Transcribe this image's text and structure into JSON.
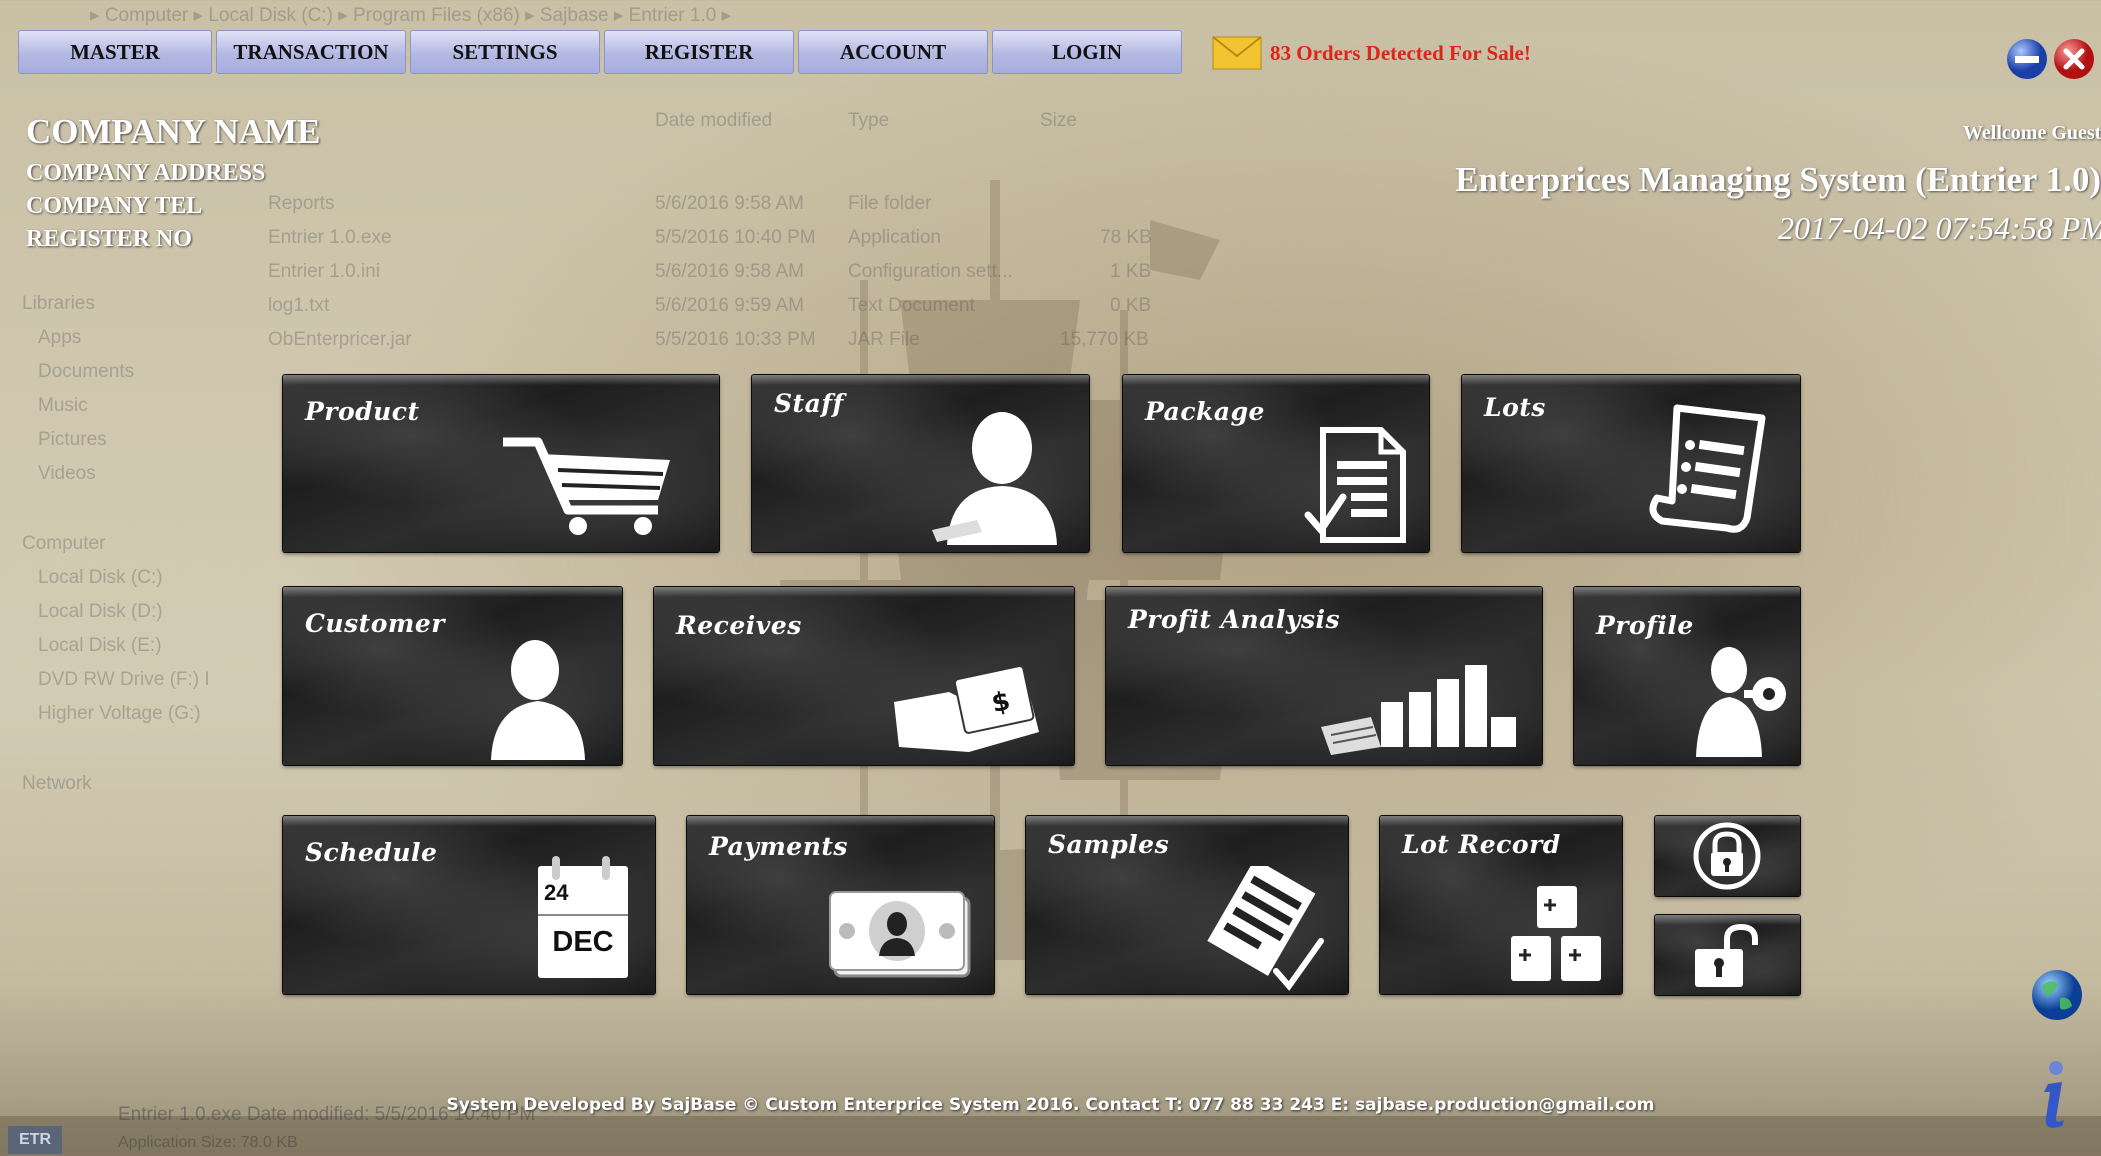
{
  "menu": {
    "items": [
      "MASTER",
      "TRANSACTION",
      "SETTINGS",
      "REGISTER",
      "ACCOUNT",
      "LOGIN"
    ]
  },
  "notification": {
    "text": "83 Orders Detected For Sale!"
  },
  "company": {
    "name": "COMPANY NAME",
    "address": "COMPANY ADDRESS",
    "tel": "COMPANY TEL",
    "register": "REGISTER NO"
  },
  "header": {
    "welcome": "Wellcome Guest !",
    "system": "Enterprices Managing System (Entrier 1.0)",
    "datetime": "2017-04-02 07:54:58 PM"
  },
  "tiles": {
    "product": "Product",
    "staff": "Staff",
    "package": "Package",
    "lots": "Lots",
    "customer": "Customer",
    "receives": "Receives",
    "profit": "Profit Analysis",
    "profile": "Profile",
    "schedule": "Schedule",
    "payments": "Payments",
    "samples": "Samples",
    "lot_record": "Lot Record"
  },
  "calendar": {
    "day": "24",
    "month": "DEC"
  },
  "footer": "System Developed By SajBase © Custom Enterprice System 2016. Contact T: 077 88 33 243 E: sajbase.production@gmail.com",
  "ghost": {
    "breadcrumb": "▸ Computer ▸ Local Disk (C:) ▸ Program Files (x86) ▸ Sajbase ▸ Entrier 1.0 ▸",
    "columns": [
      "Date modified",
      "Type",
      "Size"
    ],
    "files": [
      {
        "name": "Reports",
        "date": "5/6/2016 9:58 AM",
        "type": "File folder",
        "size": ""
      },
      {
        "name": "Entrier 1.0.exe",
        "date": "5/5/2016 10:40 PM",
        "type": "Application",
        "size": "78 KB"
      },
      {
        "name": "Entrier 1.0.ini",
        "date": "5/6/2016 9:58 AM",
        "type": "Configuration sett...",
        "size": "1 KB"
      },
      {
        "name": "log1.txt",
        "date": "5/6/2016 9:59 AM",
        "type": "Text Document",
        "size": "0 KB"
      },
      {
        "name": "ObEnterpricer.jar",
        "date": "5/5/2016 10:33 PM",
        "type": "JAR File",
        "size": "15,770 KB"
      }
    ],
    "side": [
      "Libraries",
      "Apps",
      "Documents",
      "Music",
      "Pictures",
      "Videos",
      "Computer",
      "Local Disk (C:)",
      "Local Disk (D:)",
      "Local Disk (E:)",
      "DVD RW Drive (F:) I",
      "Higher Voltage (G:)",
      "Network"
    ],
    "status": "Entrier 1.0.exe  Date modified: 5/5/2016 10:40 PM",
    "status2": "Application            Size: 78.0 KB"
  },
  "colors": {
    "menu_bg": "#b4b9e3",
    "tile_bg": "#1e1e1e",
    "orders": "#e0241b",
    "background": "#cfc6ad"
  }
}
